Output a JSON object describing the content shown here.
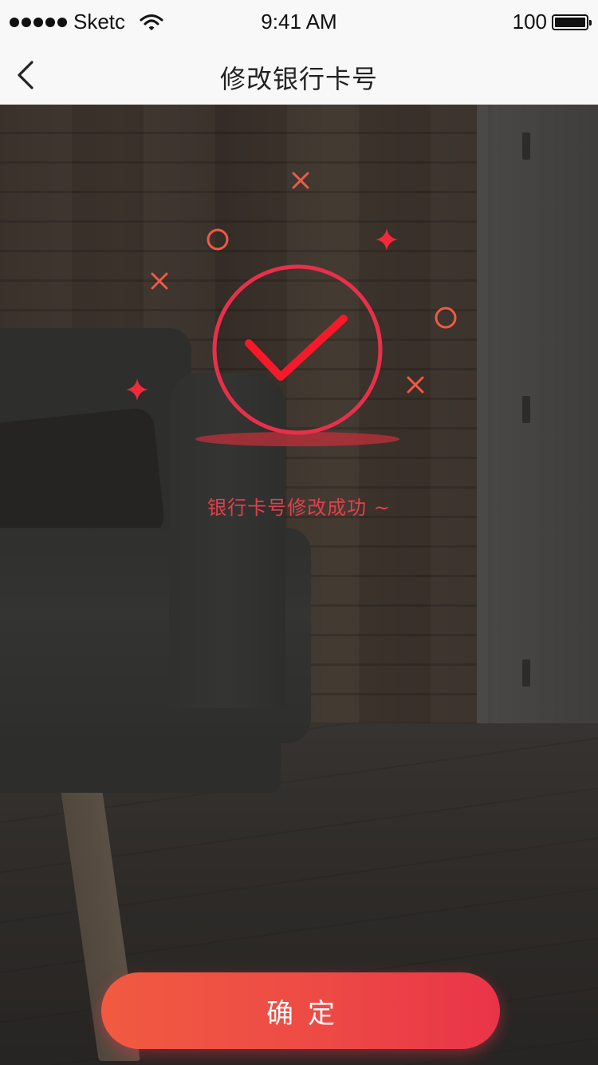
{
  "status_bar": {
    "carrier": "Sketc",
    "time": "9:41 AM",
    "battery": "100",
    "icons": [
      "signal-dots-icon",
      "wifi-icon",
      "battery-icon"
    ]
  },
  "nav": {
    "title": "修改银行卡号",
    "back_icon": "chevron-left-icon"
  },
  "success": {
    "message": "银行卡号修改成功 ~",
    "icon": "check-circle-icon",
    "decorations": [
      "cross-icon",
      "circle-icon",
      "sparkle-icon"
    ]
  },
  "confirm_button": {
    "label": "确定"
  },
  "colors": {
    "accent": "#e93448",
    "accent_start": "#f15a41",
    "decoration": "#ee5a46",
    "bar_background": "#f8f8f8"
  }
}
